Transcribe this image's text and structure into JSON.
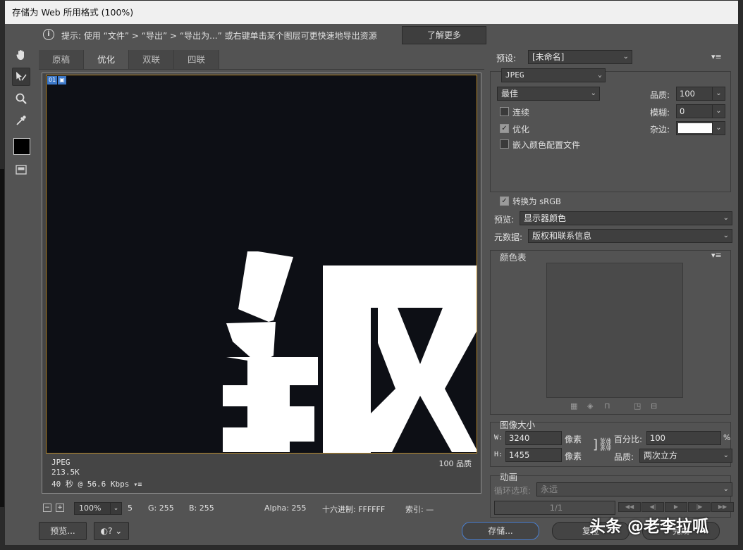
{
  "window": {
    "title": "存储为 Web 所用格式 (100%)"
  },
  "infobar": {
    "text": "提示: 使用 “文件” > “导出” > “导出为...” 或右键单击某个图层可更快速地导出资源",
    "learn_more": "了解更多"
  },
  "tools": [
    "hand-tool",
    "slice-select-tool",
    "zoom-tool",
    "eyedropper-tool"
  ],
  "tabs": [
    {
      "label": "原稿",
      "active": false
    },
    {
      "label": "优化",
      "active": true
    },
    {
      "label": "双联",
      "active": false
    },
    {
      "label": "四联",
      "active": false
    }
  ],
  "canvas": {
    "badge_num": "01",
    "badge_icon": "image-icon",
    "format": "JPEG",
    "size": "213.5K",
    "time": "40 秒 @ 56.6 Kbps",
    "quality": "100 品质"
  },
  "statusbar": {
    "zoom": "100%",
    "r": "5",
    "g": "G: 255",
    "b": "B: 255",
    "alpha": "Alpha: 255",
    "hex": "十六进制: FFFFFF",
    "index": "索引: —"
  },
  "buttons": {
    "preview": "预览...",
    "save": "存储...",
    "reset": "复位",
    "done": "完成"
  },
  "settings": {
    "preset_label": "预设:",
    "preset_value": "[未命名]",
    "format_value": "JPEG",
    "compression_value": "最佳",
    "quality_label": "品质:",
    "quality_value": "100",
    "blur_label": "模糊:",
    "blur_value": "0",
    "matte_label": "杂边:",
    "matte_color": "#ffffff",
    "progressive_label": "连续",
    "progressive": false,
    "optimized_label": "优化",
    "optimized": true,
    "embed_label": "嵌入颜色配置文件",
    "embed": false,
    "srgb_label": "转换为 sRGB",
    "srgb": true,
    "preview_label": "预览:",
    "preview_value": "显示器颜色",
    "metadata_label": "元数据:",
    "metadata_value": "版权和联系信息"
  },
  "color_table": {
    "title": "颜色表"
  },
  "image_size": {
    "title": "图像大小",
    "w_label": "W:",
    "w_value": "3240",
    "h_label": "H:",
    "h_value": "1455",
    "unit": "像素",
    "percent_label": "百分比:",
    "percent_value": "100",
    "percent_unit": "%",
    "quality_label": "品质:",
    "quality_value": "两次立方"
  },
  "animation": {
    "title": "动画",
    "loop_label": "循环选项:",
    "loop_value": "永远",
    "frame": "1/1"
  },
  "watermark": "头条 @老李拉呱",
  "colors": {
    "accent": "#4a7fd0",
    "canvas_bg": "#0d0f15",
    "badge": "#3d79c9"
  }
}
